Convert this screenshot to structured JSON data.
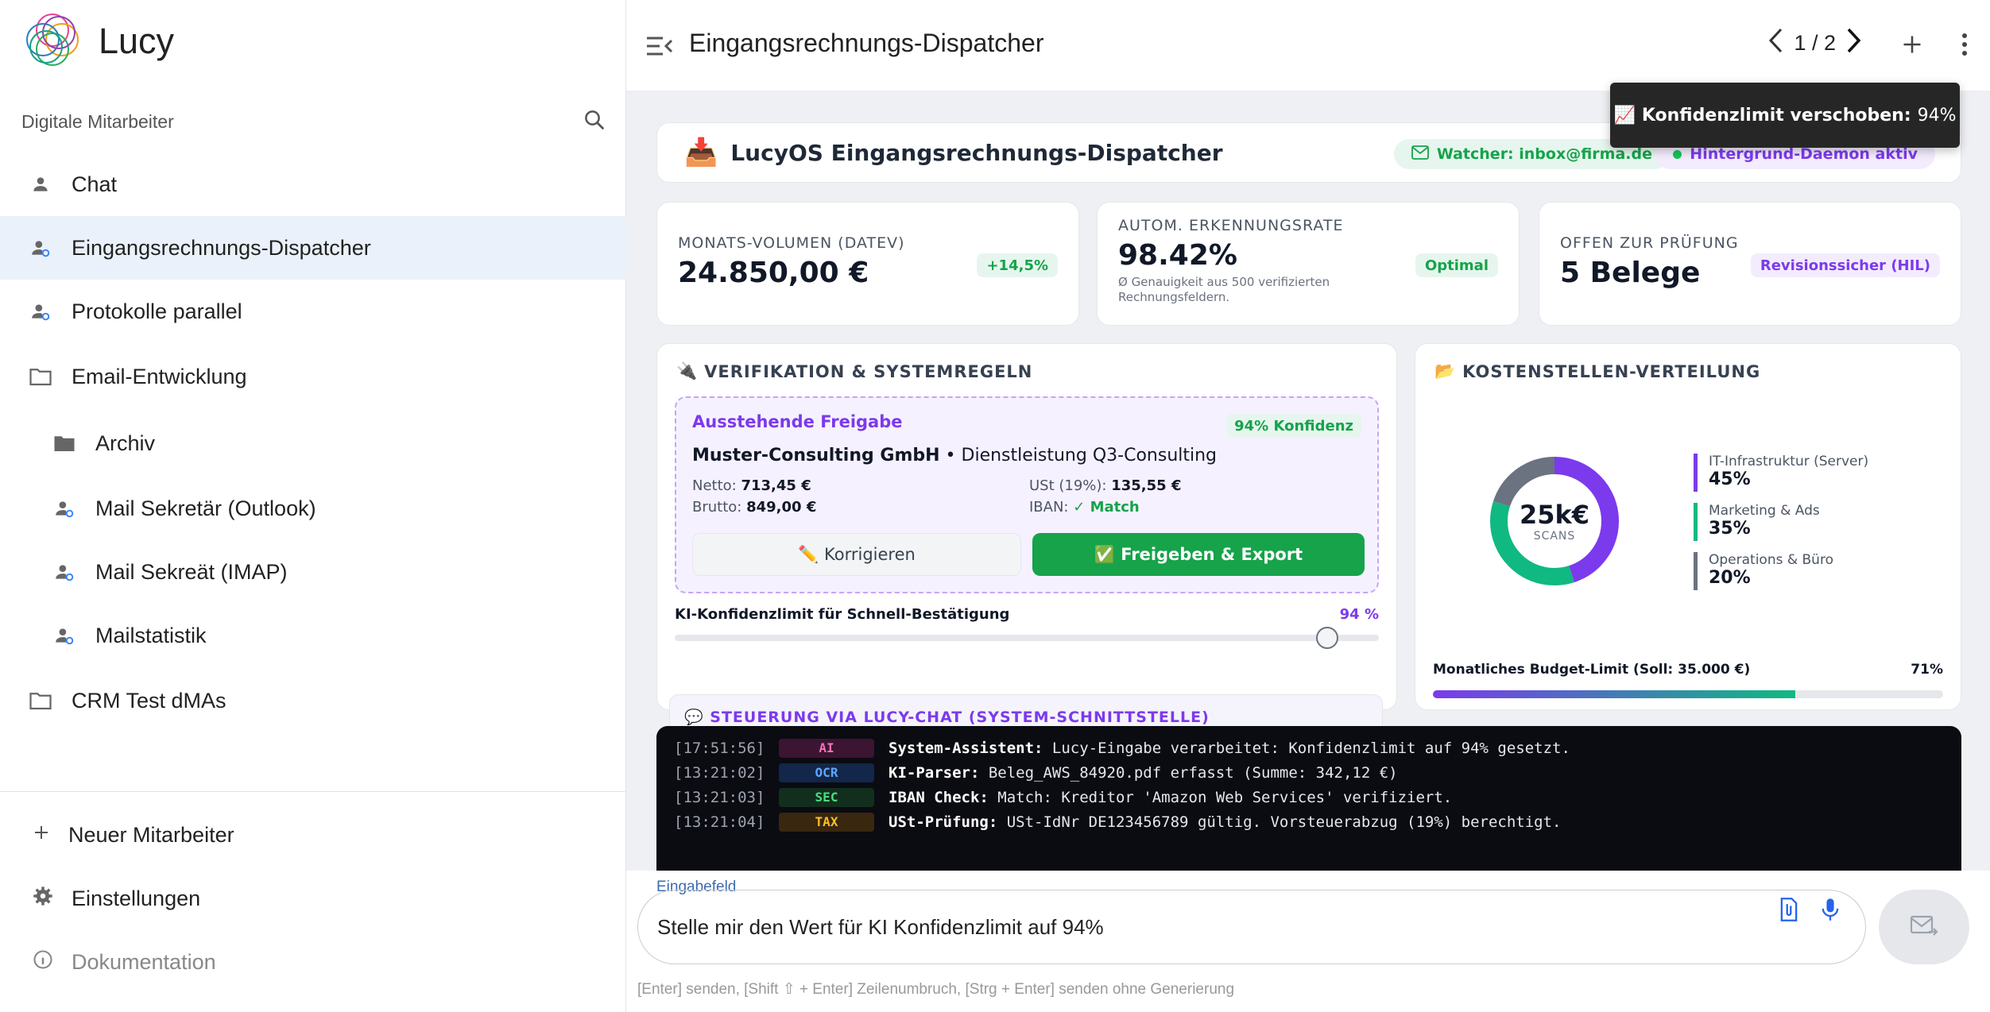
{
  "app": {
    "name": "Lucy"
  },
  "sidebar": {
    "section_label": "Digitale Mitarbeiter",
    "items": [
      {
        "label": "Chat",
        "icon": "person-icon",
        "active": false,
        "sub": false
      },
      {
        "label": "Eingangsrechnungs-Dispatcher",
        "icon": "person-gear-icon",
        "active": true,
        "sub": false
      },
      {
        "label": "Protokolle parallel",
        "icon": "person-gear-icon",
        "active": false,
        "sub": false
      },
      {
        "label": "Email-Entwicklung",
        "icon": "folder-outline-icon",
        "active": false,
        "sub": false
      },
      {
        "label": "Archiv",
        "icon": "folder-filled-icon",
        "active": false,
        "sub": true
      },
      {
        "label": "Mail Sekretär (Outlook)",
        "icon": "person-gear-icon",
        "active": false,
        "sub": true
      },
      {
        "label": "Mail Sekreät (IMAP)",
        "icon": "person-gear-icon",
        "active": false,
        "sub": true
      },
      {
        "label": "Mailstatistik",
        "icon": "person-gear-icon",
        "active": false,
        "sub": true
      },
      {
        "label": "CRM Test dMAs",
        "icon": "folder-outline-icon",
        "active": false,
        "sub": false
      }
    ],
    "bottom": [
      {
        "label": "Neuer Mitarbeiter",
        "icon": "plus-icon"
      },
      {
        "label": "Einstellungen",
        "icon": "gear-icon"
      },
      {
        "label": "Dokumentation",
        "icon": "info-icon"
      }
    ]
  },
  "header": {
    "title": "Eingangsrechnungs-Dispatcher",
    "pager": "1 / 2"
  },
  "toast": {
    "emoji": "📈",
    "label": "Konfidenzlimit verschoben:",
    "value": "94%"
  },
  "dashboard": {
    "title_emoji": "📥",
    "title": "LucyOS Eingangsrechnungs-Dispatcher",
    "watcher": "Watcher: inbox@firma.de",
    "daemon": "Hintergrund-Daemon aktiv",
    "kpis": [
      {
        "label": "MONATS-VOLUMEN (DATEV)",
        "value": "24.850,00 €",
        "sub": "",
        "badge": "+14,5%",
        "badge_color": "green"
      },
      {
        "label": "AUTOM. ERKENNUNGSRATE",
        "value": "98.42%",
        "sub": "Ø Genauigkeit aus 500 verifizierten Rechnungsfeldern.",
        "badge": "Optimal",
        "badge_color": "green"
      },
      {
        "label": "OFFEN ZUR PRÜFUNG",
        "value": "5 Belege",
        "sub": "",
        "badge": "Revisionssicher (HIL)",
        "badge_color": "purple"
      }
    ],
    "verification": {
      "heading_emoji": "🔌",
      "heading": "VERIFIKATION & SYSTEMREGELN",
      "pending_title": "Ausstehende Freigabe",
      "confidence_badge": "94% Konfidenz",
      "vendor": "Muster-Consulting GmbH",
      "service": " • Dienstleistung Q3-Consulting",
      "netto_label": "Netto:",
      "netto": "713,45 €",
      "ust_label": "USt (19%):",
      "ust": "135,55 €",
      "brutto_label": "Brutto:",
      "brutto": "849,00 €",
      "iban_label": "IBAN:",
      "iban": "✓ Match",
      "btn_correct": "✏️ Korrigieren",
      "btn_approve": "✅ Freigeben & Export",
      "slider_label": "KI-Konfidenzlimit für Schnell-Bestätigung",
      "slider_value_text": "94 %",
      "slider_value": 0.94
    },
    "chat_control": "💬 STEUERUNG VIA LUCY-CHAT (SYSTEM-SCHNITTSTELLE)",
    "cost": {
      "heading_emoji": "📂",
      "heading": "KOSTENSTELLEN-VERTEILUNG",
      "center_value": "25k€",
      "center_label": "SCANS",
      "segments": [
        {
          "name": "IT-Infrastruktur (Server)",
          "value_text": "45%",
          "value": 45,
          "color": "#7c3aed"
        },
        {
          "name": "Marketing & Ads",
          "value_text": "35%",
          "value": 35,
          "color": "#10b981"
        },
        {
          "name": "Operations & Büro",
          "value_text": "20%",
          "value": 20,
          "color": "#6b7280"
        }
      ],
      "budget_label": "Monatliches Budget-Limit (Soll: 35.000 €)",
      "budget_value_text": "71%",
      "budget_value": 0.71
    },
    "logs": [
      {
        "ts": "[17:51:56]",
        "tag": "AI",
        "tag_class": "ai",
        "source": "System-Assistent:",
        "msg": " Lucy-Eingabe verarbeitet: Konfidenzlimit auf 94% gesetzt."
      },
      {
        "ts": "[13:21:02]",
        "tag": "OCR",
        "tag_class": "ocr",
        "source": "KI-Parser:",
        "msg": " Beleg_AWS_84920.pdf erfasst (Summe: 342,12 €)"
      },
      {
        "ts": "[13:21:03]",
        "tag": "SEC",
        "tag_class": "sec",
        "source": "IBAN Check:",
        "msg": " Match: Kreditor 'Amazon Web Services' verifiziert."
      },
      {
        "ts": "[13:21:04]",
        "tag": "TAX",
        "tag_class": "tax",
        "source": "USt-Prüfung:",
        "msg": " USt-IdNr DE123456789 gültig. Vorsteuerabzug (19%) berechtigt."
      }
    ]
  },
  "input": {
    "label": "Eingabefeld",
    "value": "Stelle mir den Wert für KI Konfidenzlimit auf 94%",
    "hint": "[Enter] senden, [Shift ⇧ + Enter] Zeilenumbruch, [Strg + Enter] senden ohne Generierung"
  }
}
